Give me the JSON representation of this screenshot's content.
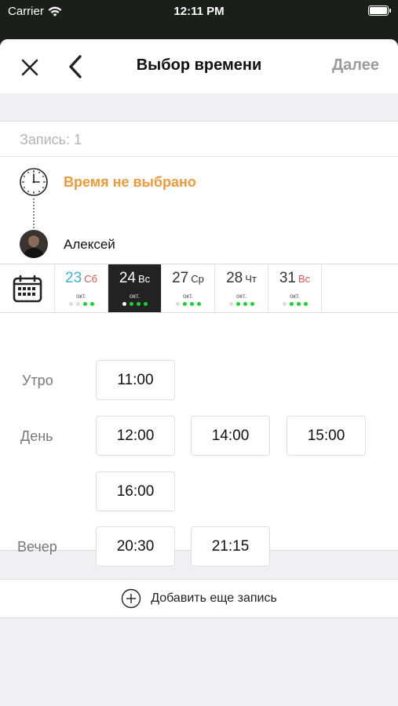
{
  "status_bar": {
    "carrier": "Carrier",
    "time": "12:11 PM"
  },
  "nav": {
    "title": "Выбор времени",
    "next_label": "Далее"
  },
  "record": {
    "label": "Запись: 1"
  },
  "booking": {
    "time_status": "Время не выбрано",
    "master_name": "Алексей"
  },
  "dates": [
    {
      "day": "23",
      "weekday": "Сб",
      "month": "окт.",
      "day_color": "#3bb3d6",
      "weekday_color": "#e05050",
      "selected": false,
      "dots": [
        "#dcdcdc",
        "#dcdcdc",
        "#18d630",
        "#18d630"
      ]
    },
    {
      "day": "24",
      "weekday": "Вс",
      "month": "окт.",
      "day_color": "#ffffff",
      "weekday_color": "#ffffff",
      "selected": true,
      "dots": [
        "#ffffff",
        "#18d630",
        "#18d630",
        "#18d630"
      ]
    },
    {
      "day": "27",
      "weekday": "Ср",
      "month": "окт.",
      "day_color": "#333333",
      "weekday_color": "#333333",
      "selected": false,
      "dots": [
        "#dcdcdc",
        "#18d630",
        "#18d630",
        "#18d630"
      ]
    },
    {
      "day": "28",
      "weekday": "Чт",
      "month": "окт.",
      "day_color": "#333333",
      "weekday_color": "#333333",
      "selected": false,
      "dots": [
        "#dcdcdc",
        "#18d630",
        "#18d630",
        "#18d630"
      ]
    },
    {
      "day": "31",
      "weekday": "Вс",
      "month": "окт.",
      "day_color": "#333333",
      "weekday_color": "#e05050",
      "selected": false,
      "dots": [
        "#dcdcdc",
        "#18d630",
        "#18d630",
        "#18d630"
      ]
    }
  ],
  "periods": {
    "morning": {
      "label": "Утро",
      "slots": [
        "11:00"
      ]
    },
    "day": {
      "label": "День",
      "slots": [
        "12:00",
        "14:00",
        "15:00",
        "16:00"
      ]
    },
    "evening": {
      "label": "Вечер",
      "slots": [
        "20:30",
        "21:15"
      ]
    }
  },
  "add_record": {
    "label": "Добавить еще запись"
  },
  "colors": {
    "accent_orange": "#ef9a3a",
    "available_green": "#18d630",
    "selected_bg": "#222222"
  },
  "icons": [
    "wifi-icon",
    "battery-icon",
    "close-icon",
    "chevron-left-icon",
    "clock-icon",
    "calendar-icon",
    "plus-circle-icon"
  ]
}
